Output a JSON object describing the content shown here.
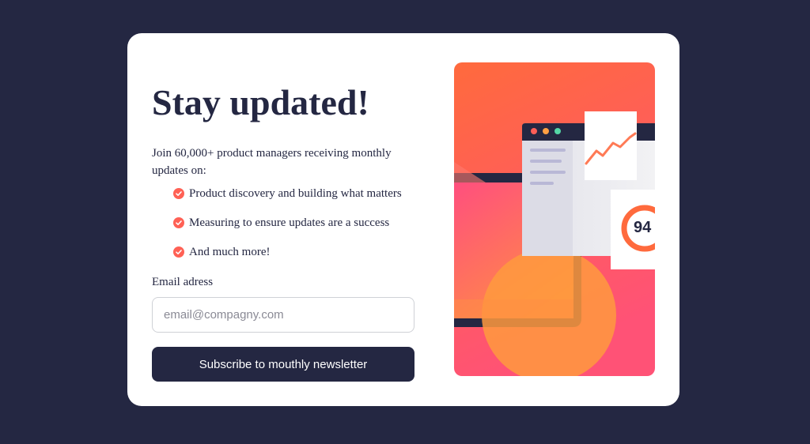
{
  "heading": "Stay updated!",
  "intro": "Join 60,000+ product managers receiving monthly updates on:",
  "benefits": [
    "Product discovery and building what matters",
    "Measuring to ensure updates are a success",
    "And much more!"
  ],
  "form": {
    "email_label": "Email adress",
    "email_placeholder": "email@compagny.com",
    "email_value": "",
    "submit_label": "Subscribe to mouthly newsletter"
  },
  "illustration": {
    "score": "94"
  },
  "colors": {
    "background": "#242742",
    "card": "#ffffff",
    "accent": "#ff6155",
    "text": "#242742"
  },
  "icons": [
    "check-icon"
  ]
}
